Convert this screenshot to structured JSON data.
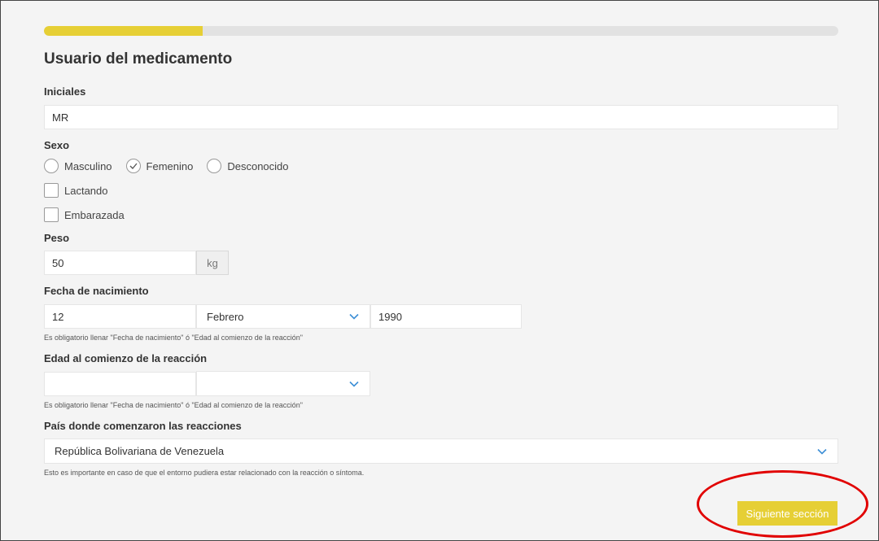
{
  "progress": {
    "fraction": 0.2
  },
  "section_title": "Usuario del medicamento",
  "initials": {
    "label": "Iniciales",
    "value": "MR"
  },
  "sex": {
    "label": "Sexo",
    "options": [
      "Masculino",
      "Femenino",
      "Desconocido"
    ],
    "selected": "Femenino"
  },
  "checkboxes": {
    "lactating": "Lactando",
    "pregnant": "Embarazada"
  },
  "weight": {
    "label": "Peso",
    "value": "50",
    "unit": "kg"
  },
  "birth_date": {
    "label": "Fecha de nacimiento",
    "day": "12",
    "month": "Febrero",
    "year": "1990",
    "hint": "Es obligatorio llenar \"Fecha de nacimiento\" ó \"Edad al comienzo de la reacción\""
  },
  "age_onset": {
    "label": "Edad al comienzo de la reacción",
    "value": "",
    "unit": "",
    "hint": "Es obligatorio llenar \"Fecha de nacimiento\" ó \"Edad al comienzo de la reacción\""
  },
  "country": {
    "label": "País donde comenzaron las reacciones",
    "value": "República Bolivariana de Venezuela",
    "hint": "Esto es importante en caso de que el entorno pudiera estar relacionado con la reacción o síntoma."
  },
  "next_button": "Siguiente sección",
  "colors": {
    "accent": "#e6cf35",
    "annotation": "#e10000",
    "chevron": "#3d8fd6"
  },
  "icons": {
    "select": "chevron-down-icon",
    "radio_checked": "check-icon"
  }
}
